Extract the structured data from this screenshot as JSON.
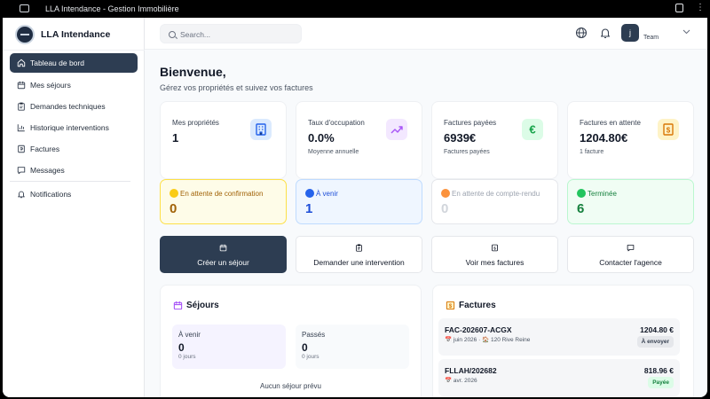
{
  "window": {
    "title": "LLA Intendance - Gestion Immobilière"
  },
  "sidebar": {
    "brand": "LLA Intendance",
    "items": [
      {
        "label": "Tableau de bord",
        "icon": "home-icon",
        "active": true
      },
      {
        "label": "Mes séjours",
        "icon": "calendar-icon"
      },
      {
        "label": "Demandes techniques",
        "icon": "clipboard-icon"
      },
      {
        "label": "Historique interventions",
        "icon": "bar-chart-icon"
      },
      {
        "label": "Factures",
        "icon": "receipt-icon"
      },
      {
        "label": "Messages",
        "icon": "message-icon"
      },
      {
        "label": "Notifications",
        "icon": "bell-icon"
      }
    ]
  },
  "header": {
    "search_placeholder": "Search...",
    "user_initial": "j",
    "user_name": "Team",
    "icons": [
      "globe-icon",
      "bell-icon",
      "chevron-down-icon"
    ]
  },
  "welcome": {
    "title": "Bienvenue,",
    "subtitle": "Gérez vos propriétés et suivez vos factures"
  },
  "stats": [
    {
      "label": "Mes propriétés",
      "value": "1",
      "sub": "",
      "icon": "building-icon",
      "color": "#2563eb",
      "bg": "#dbeafe"
    },
    {
      "label": "Taux d'occupation",
      "value": "0.0%",
      "sub": "Moyenne annuelle",
      "icon": "trend-up-icon",
      "color": "#a855f7",
      "bg": "#f3e8ff"
    },
    {
      "label": "Factures payées",
      "value": "6939€",
      "sub": "Factures payées",
      "icon": "euro-icon",
      "color": "#16a34a",
      "bg": "#dcfce7"
    },
    {
      "label": "Factures en attente",
      "value": "1204.80€",
      "sub": "1 facture",
      "icon": "dollar-doc-icon",
      "color": "#d97706",
      "bg": "#fef3c7"
    }
  ],
  "statuses": [
    {
      "label": "En attente de confirmation",
      "count": "0",
      "dot": "#facc15",
      "bg": "#fefce8",
      "border": "#fde047",
      "text": "#a16207"
    },
    {
      "label": "À venir",
      "count": "1",
      "dot": "#2563eb",
      "bg": "#eff6ff",
      "border": "#bfdbfe",
      "text": "#1d4ed8"
    },
    {
      "label": "En attente de compte-rendu",
      "count": "0",
      "dot": "#fb923c",
      "bg": "#ffffff",
      "border": "#e5e7eb",
      "text": "#9ca3af"
    },
    {
      "label": "Terminée",
      "count": "6",
      "dot": "#22c55e",
      "bg": "#f0fdf4",
      "border": "#bbf7d0",
      "text": "#15803d"
    }
  ],
  "actions": [
    {
      "label": "Créer un séjour",
      "icon": "calendar-icon",
      "primary": true
    },
    {
      "label": "Demander une intervention",
      "icon": "clipboard-icon"
    },
    {
      "label": "Voir mes factures",
      "icon": "dollar-doc-icon"
    },
    {
      "label": "Contacter l'agence",
      "icon": "message-icon"
    }
  ],
  "sejours": {
    "title": "Séjours",
    "upcoming": {
      "label": "À venir",
      "count": "0",
      "sub": "0 jours"
    },
    "past": {
      "label": "Passés",
      "count": "0",
      "sub": "0 jours"
    },
    "empty": "Aucun séjour prévu"
  },
  "factures": {
    "title": "Factures",
    "items": [
      {
        "number": "FAC-202607-ACGX",
        "meta": "📅 juin 2026 · 🏠 120 Rive Reine",
        "amount": "1204.80 €",
        "badge": "À envoyer",
        "badge_bg": "#e5e7eb",
        "badge_color": "#374151"
      },
      {
        "number": "FLLAH/202682",
        "meta": "📅 avr. 2026",
        "amount": "818.96 €",
        "badge": "Payée",
        "badge_bg": "#dcfce7",
        "badge_color": "#15803d"
      }
    ]
  }
}
